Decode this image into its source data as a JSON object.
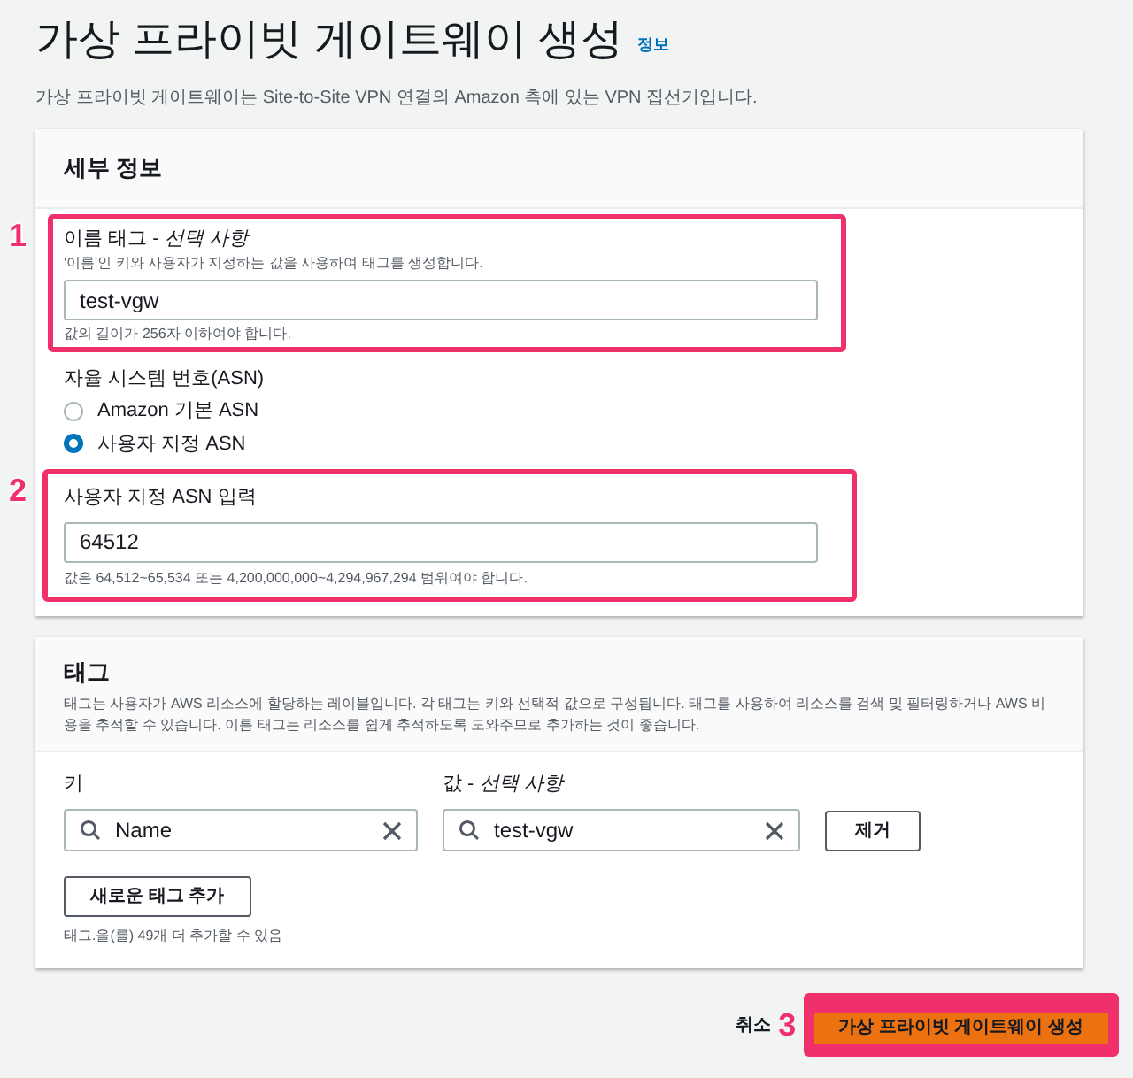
{
  "page": {
    "title": "가상 프라이빗 게이트웨이 생성",
    "info_link": "정보",
    "description": "가상 프라이빗 게이트웨이는 Site-to-Site VPN 연결의 Amazon 측에 있는 VPN 집선기입니다."
  },
  "details": {
    "heading": "세부 정보",
    "name_tag": {
      "annotation": "1",
      "label": "이름 태그 - *선택 사항*",
      "hint": "'이름'인 키와 사용자가 지정하는 값을 사용하여 태그를 생성합니다.",
      "value": "test-vgw",
      "constraint": "값의 길이가 256자 이하여야 합니다."
    },
    "asn": {
      "label": "자율 시스템 번호(ASN)",
      "options": [
        {
          "label": "Amazon 기본 ASN",
          "selected": false
        },
        {
          "label": "사용자 지정 ASN",
          "selected": true
        }
      ],
      "custom": {
        "annotation": "2",
        "label": "사용자 지정 ASN 입력",
        "value": "64512",
        "constraint": "값은 64,512~65,534 또는 4,200,000,000~4,294,967,294 범위여야 합니다."
      }
    }
  },
  "tags": {
    "heading": "태그",
    "description": "태그는 사용자가 AWS 리소스에 할당하는 레이블입니다. 각 태그는 키와 선택적 값으로 구성됩니다. 태그를 사용하여 리소스를 검색 및 필터링하거나 AWS 비용을 추적할 수 있습니다. 이름 태그는 리소스를 쉽게 추적하도록 도와주므로 추가하는 것이 좋습니다.",
    "key_label": "키",
    "value_label": "값 - *선택 사항*",
    "rows": [
      {
        "key": "Name",
        "value": "test-vgw",
        "remove": "제거"
      }
    ],
    "add_button": "새로운 태그 추가",
    "limit_note": "태그.을(를) 49개 더 추가할 수 있음"
  },
  "footer": {
    "cancel": "취소",
    "annotation": "3",
    "submit": "가상 프라이빗 게이트웨이 생성"
  }
}
